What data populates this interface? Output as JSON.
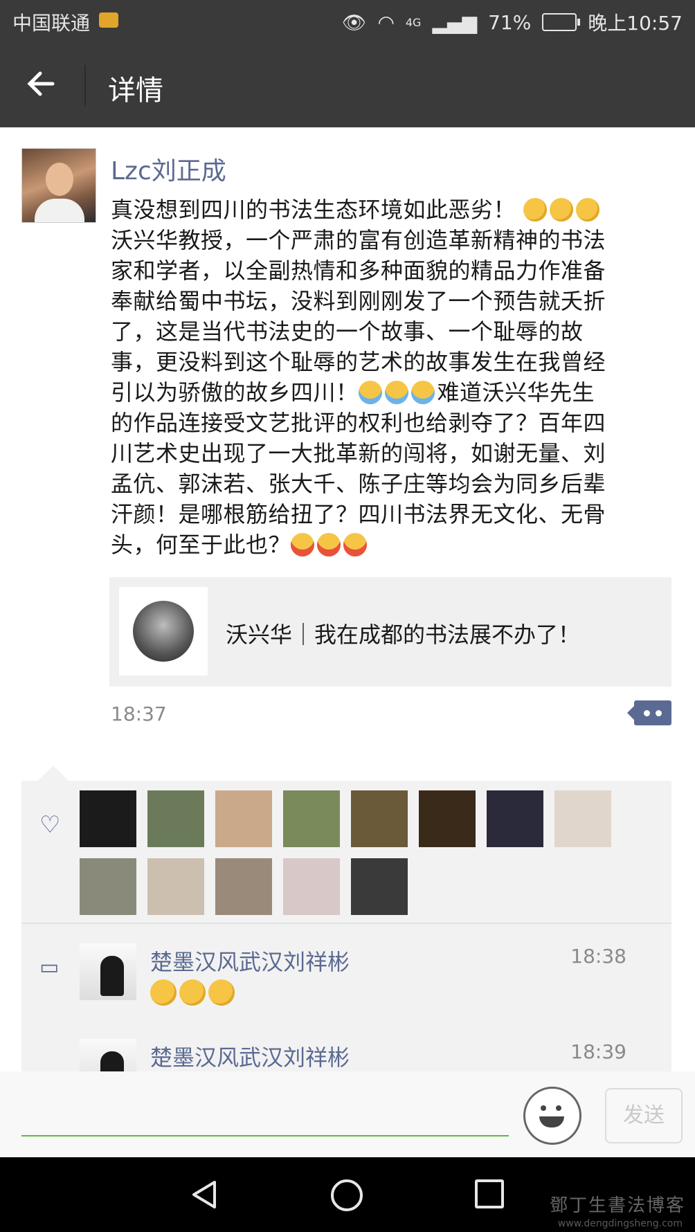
{
  "status": {
    "carrier": "中国联通",
    "network": "4G",
    "battery": "71%",
    "time": "晚上10:57"
  },
  "header": {
    "title": "详情"
  },
  "post": {
    "author": "Lzc刘正成",
    "lines": [
      "真没想到四川的书法生态环境如此恶劣！",
      "沃兴华教授，一个严肃的富有创造革新精神的书法",
      "家和学者，以全副热情和多种面貌的精品力作准备",
      "奉献给蜀中书坛，没料到刚刚发了一个预告就夭折",
      "了，这是当代书法史的一个故事、一个耻辱的故",
      "事，更没料到这个耻辱的艺术的故事发生在我曾经",
      "引以为骄傲的故乡四川！",
      "难道沃兴华先生",
      "的作品连接受文艺批评的权利也给剥夺了？百年四",
      "川艺术史出现了一大批革新的闯将，如谢无量、刘",
      "孟伉、郭沫若、张大千、陈子庄等均会为同乡后辈",
      "汗颜！是哪根筋给扭了？四川书法界无文化、无骨",
      "头，何至于此也？"
    ],
    "link_title": "沃兴华｜我在成都的书法展不办了！",
    "time": "18:37"
  },
  "likers": [
    {
      "color": "#1b1b1b"
    },
    {
      "color": "#6b7b5a"
    },
    {
      "color": "#c9a98a"
    },
    {
      "color": "#7a8a5a"
    },
    {
      "color": "#6a5a3a"
    },
    {
      "color": "#3a2a1a"
    },
    {
      "color": "#2a2a3a"
    },
    {
      "color": "#e0d6cc"
    },
    {
      "color": "#8a8a7a"
    },
    {
      "color": "#cdbfb0"
    },
    {
      "color": "#9a8a7a"
    },
    {
      "color": "#d8c8c8"
    },
    {
      "color": "#3a3a3a"
    }
  ],
  "comments": [
    {
      "name": "楚墨汉风武汉刘祥彬",
      "time": "18:38"
    },
    {
      "name": "楚墨汉风武汉刘祥彬",
      "time": "18:39"
    }
  ],
  "input": {
    "send_label": "发送"
  },
  "watermark": {
    "text": "鄧丁生書法博客",
    "url": "www.dengdingsheng.com"
  }
}
